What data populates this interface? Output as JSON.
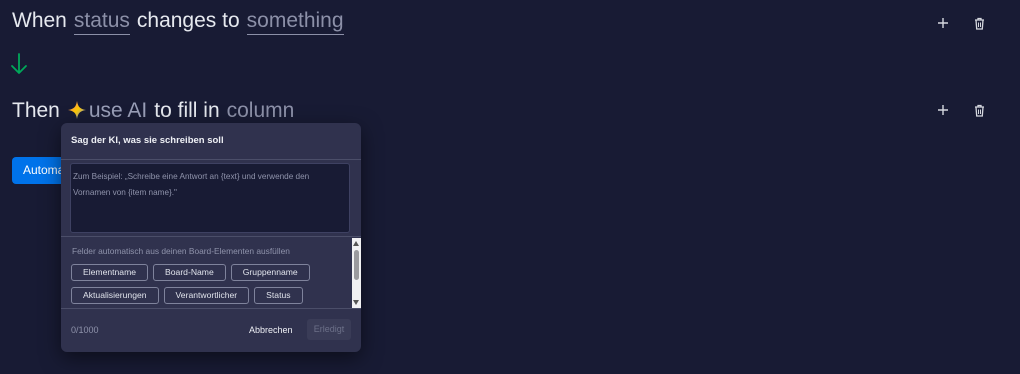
{
  "rule": {
    "when_word": "When",
    "trigger_slot": "status",
    "trigger_middle": "changes to",
    "trigger_value_slot": "something",
    "then_word": "Then",
    "action_slot": "use AI",
    "action_middle": "to fill in",
    "target_slot": "column"
  },
  "automate_button": {
    "label": "Automate"
  },
  "popup": {
    "title": "Sag der KI, was sie schreiben soll",
    "prompt_placeholder": "Zum Beispiel: „Schreibe eine Antwort an {text} und verwende den Vornamen von {item name}.\"",
    "fields_label": "Felder automatisch aus deinen Board-Elementen ausfüllen",
    "chip_rows": [
      [
        "Elementname",
        "Board-Name",
        "Gruppenname"
      ],
      [
        "Aktualisierungen",
        "Verantwortlicher",
        "Status"
      ]
    ],
    "counter": "0/1000",
    "cancel_label": "Abbrechen",
    "done_label": "Erledigt"
  },
  "icons": {
    "add": "plus-icon",
    "delete": "trash-icon",
    "flow": "arrow-down-icon",
    "ai": "sparkle-icon"
  },
  "colors": {
    "background": "#181b34",
    "accent_blue": "#0073ea",
    "flow_arrow": "#00a85a",
    "popup_bg": "#30324e"
  }
}
